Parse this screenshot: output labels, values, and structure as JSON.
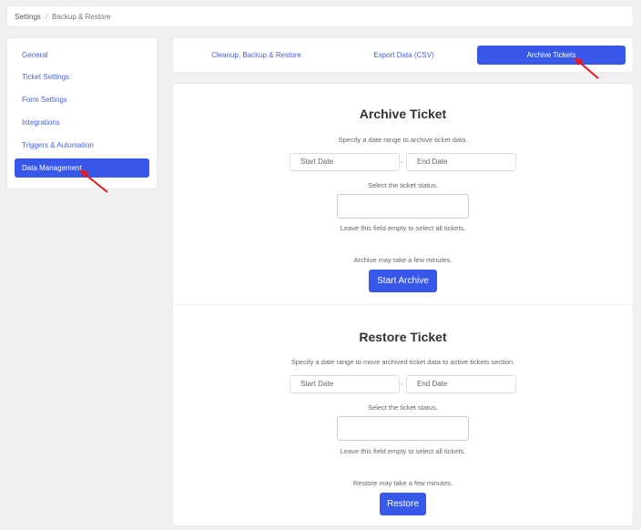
{
  "breadcrumb": {
    "root": "Settings",
    "separator": "/",
    "current": "Backup & Restore"
  },
  "sidebar": {
    "items": [
      {
        "label": "General"
      },
      {
        "label": "Ticket Settings"
      },
      {
        "label": "Form Settings"
      },
      {
        "label": "Integrations"
      },
      {
        "label": "Triggers & Automation"
      },
      {
        "label": "Data Management",
        "active": true
      }
    ]
  },
  "tabs": [
    {
      "label": "Cleanup, Backup & Restore"
    },
    {
      "label": "Export Data (CSV)"
    },
    {
      "label": "Archive Tickets",
      "active": true
    }
  ],
  "archive": {
    "title": "Archive Ticket",
    "description": "Specify a date range to archive ticket data.",
    "start_placeholder": "Start Date",
    "end_placeholder": "End Date",
    "range_separator": "-",
    "status_label": "Select the ticket status.",
    "status_hint": "Leave this field empty to select all tickets.",
    "note": "Archive may take a few minutes.",
    "button": "Start Archive"
  },
  "restore": {
    "title": "Restore Ticket",
    "description": "Specify a date range to move archived ticket data to active tickets section.",
    "start_placeholder": "Start Date",
    "end_placeholder": "End Date",
    "range_separator": "-",
    "status_label": "Select the ticket status.",
    "status_hint": "Leave this field empty to select all tickets.",
    "note": "Restore may take a few minutes.",
    "button": "Restore"
  },
  "colors": {
    "accent": "#3858e9",
    "link": "#4a5fe0",
    "annotation": "#e8191b"
  }
}
